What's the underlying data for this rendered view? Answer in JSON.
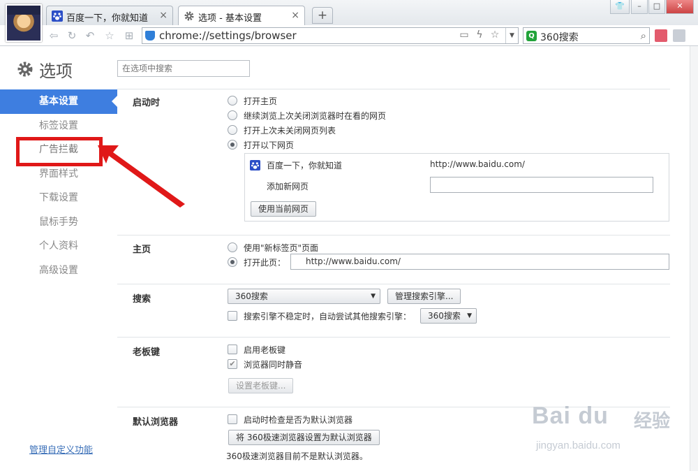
{
  "watermark": {
    "brand": "Bai du",
    "tag": "经验",
    "site": "jingyan.baidu.com"
  },
  "avatar": {
    "caption": ""
  },
  "tabs": [
    {
      "label": "百度一下，你就知道",
      "close": "×"
    },
    {
      "label": "选项 - 基本设置",
      "close": "×"
    }
  ],
  "newtab": "+",
  "window_controls": {
    "skin": "👕",
    "minimize": "–",
    "restore": "□",
    "close": "✕"
  },
  "address": {
    "url": "chrome://settings/browser"
  },
  "search": {
    "engine": "Q",
    "value": "360搜索"
  },
  "colors": {
    "accent": "#3e7ee0",
    "annotation": "#e01818"
  },
  "sidebar": {
    "title": "选项",
    "items": [
      {
        "label": "基本设置"
      },
      {
        "label": "标签设置"
      },
      {
        "label": "广告拦截"
      },
      {
        "label": "界面样式"
      },
      {
        "label": "下载设置"
      },
      {
        "label": "鼠标手势"
      },
      {
        "label": "个人资料"
      },
      {
        "label": "高级设置"
      }
    ],
    "manage_link": "管理自定义功能"
  },
  "main": {
    "search_placeholder": "在选项中搜索",
    "startup": {
      "label": "启动时",
      "options": [
        "打开主页",
        "继续浏览上次关闭浏览器时在看的网页",
        "打开上次未关闭网页列表",
        "打开以下网页"
      ],
      "selected": 3,
      "pages": [
        {
          "title": "百度一下，你就知道",
          "url": "http://www.baidu.com/"
        }
      ],
      "add_page_label": "添加新网页",
      "add_page_value": "",
      "use_current_button": "使用当前网页"
    },
    "homepage": {
      "label": "主页",
      "option_newtab": "使用\"新标签页\"页面",
      "option_open": "打开此页：",
      "url": "http://www.baidu.com/"
    },
    "search": {
      "label": "搜索",
      "engine": "360搜索",
      "manage_button": "管理搜索引擎...",
      "fallback_label": "搜索引擎不稳定时，自动尝试其他搜索引擎：",
      "fallback_engine": "360搜索"
    },
    "bosskey": {
      "label": "老板键",
      "enable": "启用老板键",
      "mute": "浏览器同时静音",
      "settings_button": "设置老板键..."
    },
    "default_browser": {
      "label": "默认浏览器",
      "check_on_start": "启动时检查是否为默认浏览器",
      "set_button": "将 360极速浏览器设置为默认浏览器",
      "status": "360极速浏览器目前不是默认浏览器。"
    }
  }
}
